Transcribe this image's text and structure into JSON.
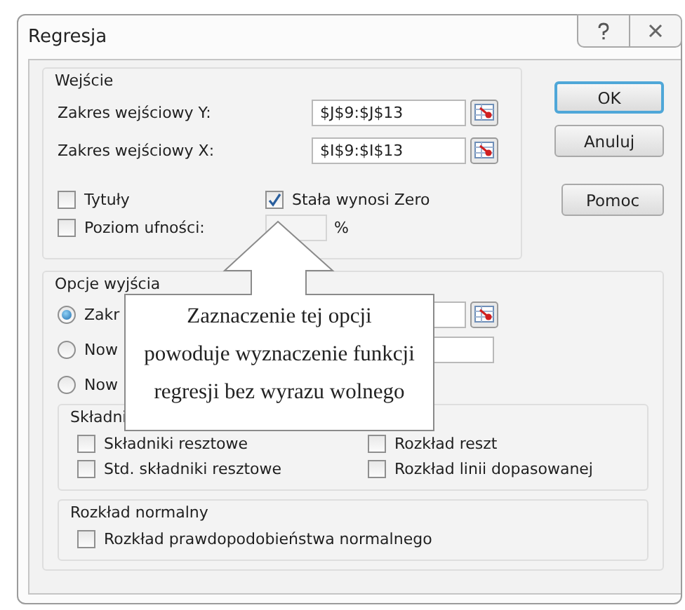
{
  "window": {
    "title": "Regresja"
  },
  "input_group": {
    "title": "Wejście",
    "ranges": [
      {
        "label": "Zakres wejściowy Y:",
        "value": "$J$9:$J$13"
      },
      {
        "label": "Zakres wejściowy X:",
        "value": "$I$9:$I$13"
      }
    ],
    "options": [
      {
        "label": "Tytuły",
        "checked": false
      },
      {
        "label": "Stała wynosi Zero",
        "checked": true
      },
      {
        "label": "Poziom ufności:",
        "checked": false
      }
    ],
    "unit": "%"
  },
  "buttons": [
    {
      "label": "OK",
      "default": true
    },
    {
      "label": "Anuluj",
      "default": false
    },
    {
      "label": "Pomoc",
      "default": false
    }
  ],
  "output_group": {
    "title": "Opcje wyjścia",
    "choices": [
      {
        "label": "Zakr",
        "selected": true
      },
      {
        "label": "Now",
        "selected": false
      },
      {
        "label": "Now",
        "selected": false
      }
    ]
  },
  "residuals_group": {
    "title": "Składni",
    "options": [
      {
        "label": "Składniki resztowe",
        "checked": false
      },
      {
        "label": "Rozkład reszt",
        "checked": false
      },
      {
        "label": "Std. składniki resztowe",
        "checked": false
      },
      {
        "label": "Rozkład linii dopasowanej",
        "checked": false
      }
    ]
  },
  "normal_group": {
    "title": "Rozkład normalny",
    "options": [
      {
        "label": "Rozkład prawdopodobieństwa normalnego",
        "checked": false
      }
    ]
  },
  "callout": {
    "lines": [
      "Zaznaczenie tej opcji",
      "powoduje wyznaczenie funkcji",
      "regresji bez wyrazu wolnego"
    ]
  }
}
